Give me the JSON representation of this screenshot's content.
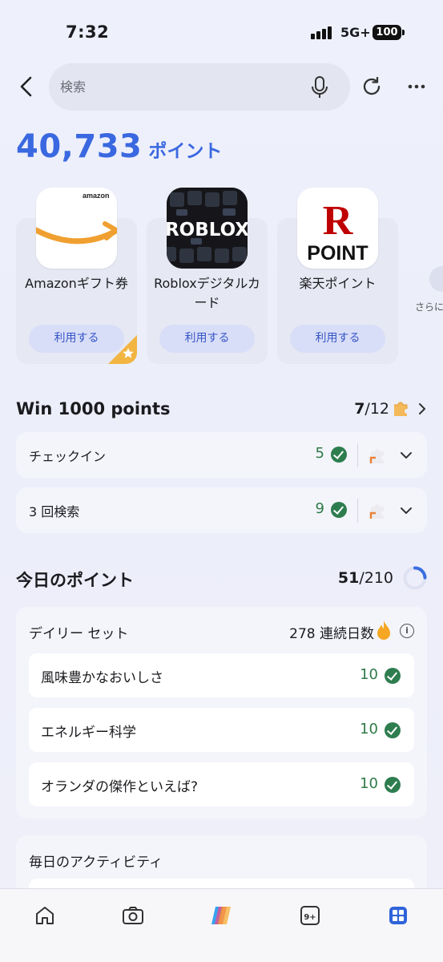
{
  "status_bar": {
    "time": "7:32",
    "network": "5G+",
    "battery": "100"
  },
  "search": {
    "placeholder": "検索"
  },
  "points": {
    "value": "40,733",
    "unit": "ポイント"
  },
  "rewards": [
    {
      "logo_text": "amazon",
      "title": "Amazonギフト券",
      "button": "利用する"
    },
    {
      "logo_text": "ROBLOX",
      "title": "Robloxデジタルカード",
      "button": "利用する"
    },
    {
      "logo_text_top": "R",
      "logo_text_bottom": "POINT",
      "title": "楽天ポイント",
      "button": "利用する"
    }
  ],
  "rewards_more": {
    "label": "さらに"
  },
  "win": {
    "title": "Win 1000 points",
    "progress_current": "7",
    "progress_total": "/12",
    "tasks": [
      {
        "label": "チェックイン",
        "value": "5"
      },
      {
        "label": "3 回検索",
        "value": "9"
      }
    ]
  },
  "today": {
    "title": "今日のポイント",
    "current": "51",
    "total": "/210",
    "progress_fraction": 0.243
  },
  "daily_set": {
    "title": "デイリー セット",
    "streak": "278 連続日数",
    "items": [
      {
        "label": "風味豊かなおいしさ",
        "value": "10"
      },
      {
        "label": "エネルギー科学",
        "value": "10"
      },
      {
        "label": "オランダの傑作といえば?",
        "value": "10"
      }
    ]
  },
  "activity": {
    "title": "毎日のアクティビティ"
  },
  "colors": {
    "accent": "#3a68e0",
    "success": "#2e7d4f",
    "button_bg": "#d9def8"
  },
  "icons": [
    "back-icon",
    "mic-icon",
    "refresh-icon",
    "more-icon",
    "puzzle-icon",
    "chevron-down-icon",
    "flame-icon",
    "info-icon",
    "home-icon",
    "camera-icon",
    "copilot-icon",
    "tabs-icon",
    "apps-icon"
  ]
}
